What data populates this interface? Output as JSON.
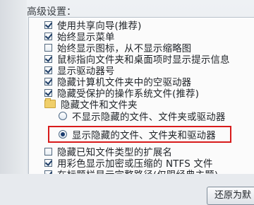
{
  "section_title": "高级设置：",
  "items": [
    {
      "type": "checkbox",
      "checked": true,
      "label": "使用共享向导(推荐)"
    },
    {
      "type": "checkbox",
      "checked": true,
      "label": "始终显示菜单"
    },
    {
      "type": "checkbox",
      "checked": false,
      "label": "始终显示图标，从不显示缩略图"
    },
    {
      "type": "checkbox",
      "checked": true,
      "label": "鼠标指向文件夹和桌面项时显示提示信息"
    },
    {
      "type": "checkbox",
      "checked": true,
      "label": "显示驱动器号"
    },
    {
      "type": "checkbox",
      "checked": true,
      "label": "隐藏计算机文件夹中的空驱动器"
    },
    {
      "type": "checkbox",
      "checked": true,
      "label": "隐藏受保护的操作系统文件(推荐)"
    },
    {
      "type": "folder",
      "label": "隐藏文件和文件夹"
    },
    {
      "type": "radio",
      "checked": false,
      "label": "不显示隐藏的文件、文件夹或驱动器"
    },
    {
      "type": "radio",
      "checked": true,
      "label": "显示隐藏的文件、文件夹和驱动器"
    },
    {
      "type": "checkbox",
      "checked": false,
      "label": "隐藏已知文件类型的扩展名"
    },
    {
      "type": "checkbox",
      "checked": true,
      "label": "用彩色显示加密或压缩的 NTFS 文件"
    },
    {
      "type": "checkbox",
      "checked": true,
      "label": "在标题栏显示完整路径(仅限经典主题)"
    }
  ],
  "restore_button_label": "还原为默"
}
